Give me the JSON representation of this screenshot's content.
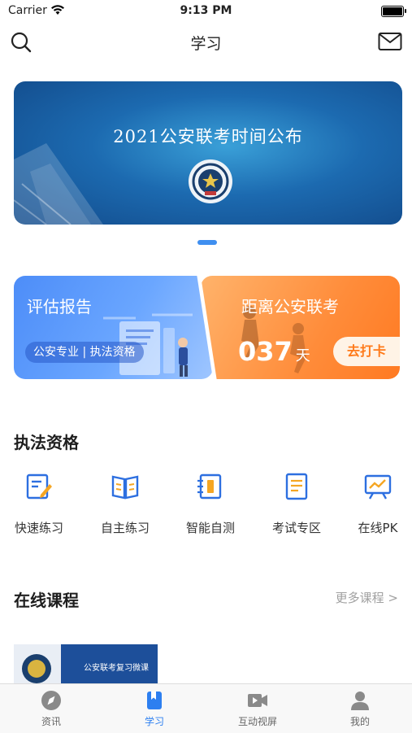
{
  "status_bar": {
    "carrier": "Carrier",
    "time": "9:13 PM"
  },
  "nav": {
    "title": "学习",
    "left_icon": "search-icon",
    "right_icon": "mail-icon"
  },
  "banner": {
    "headline": "2021公安联考时间公布",
    "emblem_icon": "police-emblem-icon",
    "page_count": 1,
    "active_page": 1
  },
  "cards": {
    "assessment": {
      "title": "评估报告",
      "tag": "公安专业 | 执法资格"
    },
    "exam": {
      "title": "距离公安联考",
      "days": "037",
      "unit": "天",
      "action": "去打卡"
    }
  },
  "section_enforcement": {
    "title": "执法资格",
    "items": [
      {
        "label": "快速练习",
        "icon": "quick-practice-icon"
      },
      {
        "label": "自主练习",
        "icon": "open-book-icon"
      },
      {
        "label": "智能自测",
        "icon": "notebook-icon"
      },
      {
        "label": "考试专区",
        "icon": "document-icon"
      },
      {
        "label": "在线PK",
        "icon": "chart-board-icon"
      }
    ]
  },
  "section_courses": {
    "title": "在线课程",
    "more": "更多课程 >",
    "course_thumb_text": "公安联考复习微课"
  },
  "tabbar": {
    "items": [
      {
        "label": "资讯",
        "icon": "compass-icon",
        "active": false
      },
      {
        "label": "学习",
        "icon": "bookmark-book-icon",
        "active": true
      },
      {
        "label": "互动视屏",
        "icon": "video-icon",
        "active": false
      },
      {
        "label": "我的",
        "icon": "person-icon",
        "active": false
      }
    ]
  },
  "colors": {
    "accent": "#2d7ff0",
    "orange": "#ff7a1a",
    "blue_card": "#4d8df8"
  }
}
